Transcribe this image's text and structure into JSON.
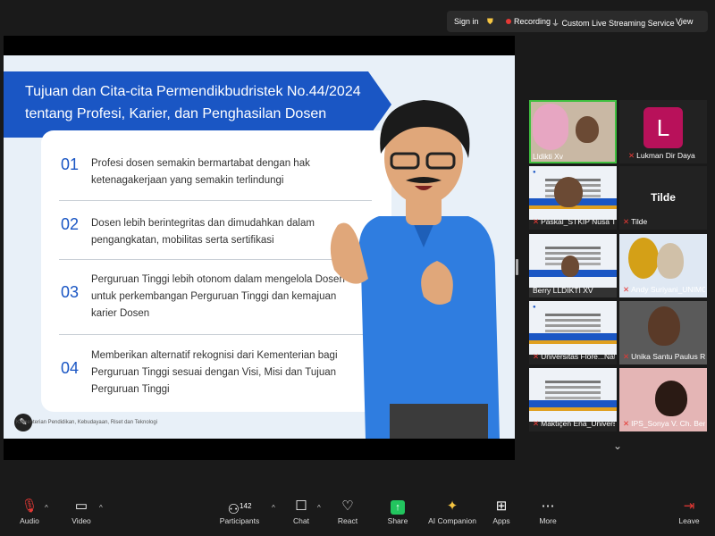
{
  "topbar": {
    "sign_in": "Sign in",
    "recording": "Recording",
    "streaming": "Custom Live Streaming Service",
    "view": "View"
  },
  "slide": {
    "title_line1": "Tujuan dan Cita-cita Permendikbudristek No.44/2024",
    "title_line2": "tentang Profesi, Karier, dan Penghasilan Dosen",
    "items": [
      {
        "num": "01",
        "line1": "Profesi dosen semakin bermartabat dengan hak",
        "line2": "ketenagakerjaan yang semakin terlindungi",
        "line3": ""
      },
      {
        "num": "02",
        "line1": "Dosen lebih berintegritas dan dimudahkan dalam",
        "line2": "pengangkatan, mobilitas serta sertifikasi",
        "line3": ""
      },
      {
        "num": "03",
        "line1": "Perguruan Tinggi lebih otonom dalam mengelola Dosen",
        "line2": "untuk perkembangan Perguruan Tinggi dan kemajuan",
        "line3": "karier Dosen"
      },
      {
        "num": "04",
        "line1": "Memberikan alternatif rekognisi dari Kementerian bagi",
        "line2": "Perguruan Tinggi sesuai dengan Visi, Misi dan Tujuan",
        "line3": "Perguruan Tinggi"
      }
    ],
    "footer": "Kementerian Pendidikan, Kebudayaan, Riset dan Teknologi"
  },
  "participants": [
    {
      "name": "Lldikti Xv",
      "type": "video",
      "muted": false
    },
    {
      "name": "Lukman Dir Daya",
      "type": "avatar",
      "letter": "L",
      "muted": true
    },
    {
      "name": "Paskal_STKIP Nusa Tim...",
      "type": "slide",
      "muted": true
    },
    {
      "name": "Tilde",
      "type": "name",
      "muted": true
    },
    {
      "name": "Berry LLDIKTI XV",
      "type": "video",
      "muted": false
    },
    {
      "name": "Andy Suriyani_UNIMOF",
      "type": "video",
      "muted": true
    },
    {
      "name": "Universitas Flore...Nat...",
      "type": "slide",
      "muted": true
    },
    {
      "name": "Unika Santu Paulus Ru...",
      "type": "video",
      "muted": true
    },
    {
      "name": "Maktiçen Ena_Universi...",
      "type": "slide",
      "muted": true
    },
    {
      "name": "IPS_Sonya V. Ch. Benu",
      "type": "video",
      "muted": true
    }
  ],
  "toolbar": {
    "audio": "Audio",
    "video": "Video",
    "participants": "Participants",
    "participant_count": "142",
    "chat": "Chat",
    "react": "React",
    "share": "Share",
    "ai_companion": "AI Companion",
    "apps": "Apps",
    "more": "More",
    "leave": "Leave"
  },
  "colors": {
    "accent_blue": "#1a56c4",
    "recording_red": "#e53935",
    "share_green": "#22c55e",
    "active_speaker": "#3fbf3f"
  }
}
